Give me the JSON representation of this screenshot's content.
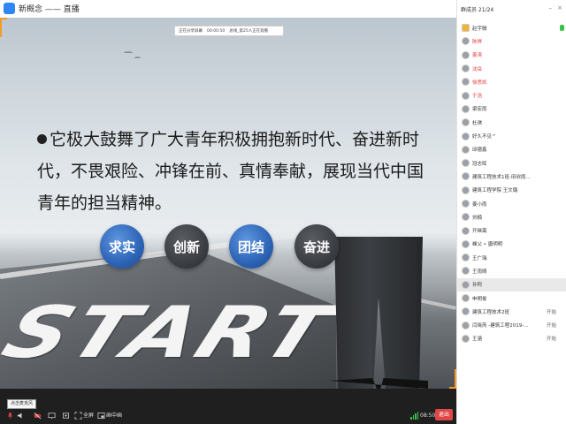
{
  "window": {
    "title": "新概念 —— 直播"
  },
  "info_bar": {
    "sharing": "正在分享屏幕",
    "timer": "00:00:50",
    "viewers": "总线_第25人正在观看"
  },
  "slide": {
    "text": "它极大鼓舞了广大青年积极拥抱新时代、奋进新时代，不畏艰险、冲锋在前、真情奉献，展现当代中国青年的担当精神。",
    "circles": [
      "求实",
      "创新",
      "团结",
      "奋进"
    ],
    "background_word": "START"
  },
  "toolbar": {
    "tooltip": "点击麦克风",
    "fullscreen_label": "全屏",
    "pip_label": "画中画",
    "time": "08:50",
    "exit_label": "退出"
  },
  "panel": {
    "header": "群成员 21/24",
    "participants": [
      {
        "name": "赵宇微",
        "style": "host",
        "status": "",
        "mic": "on"
      },
      {
        "name": "陈晔",
        "style": "red",
        "status": "",
        "mic": ""
      },
      {
        "name": "姜涛",
        "style": "red",
        "status": "",
        "mic": ""
      },
      {
        "name": "沈岳",
        "style": "red",
        "status": "",
        "mic": ""
      },
      {
        "name": "徐思凯",
        "style": "red",
        "status": "",
        "mic": ""
      },
      {
        "name": "于浩",
        "style": "red",
        "status": "",
        "mic": ""
      },
      {
        "name": "梁宏雨",
        "style": "",
        "status": "",
        "mic": ""
      },
      {
        "name": "杜琪",
        "style": "",
        "status": "",
        "mic": ""
      },
      {
        "name": "好久不见^",
        "style": "",
        "status": "",
        "mic": ""
      },
      {
        "name": "邱德鑫",
        "style": "",
        "status": "",
        "mic": ""
      },
      {
        "name": "冠志晖",
        "style": "",
        "status": "",
        "mic": ""
      },
      {
        "name": "建筑工程技术1班-田欣雨...",
        "style": "",
        "status": "",
        "mic": ""
      },
      {
        "name": "建筑工程学院 王文璐",
        "style": "",
        "status": "",
        "mic": ""
      },
      {
        "name": "姜小雨",
        "style": "",
        "status": "",
        "mic": ""
      },
      {
        "name": "刘楠",
        "style": "",
        "status": "",
        "mic": ""
      },
      {
        "name": "开继嵩",
        "style": "",
        "status": "",
        "mic": ""
      },
      {
        "name": "峰父 • 唐明明",
        "style": "",
        "status": "",
        "mic": ""
      },
      {
        "name": "王广瑞",
        "style": "",
        "status": "",
        "mic": ""
      },
      {
        "name": "王雨晴",
        "style": "",
        "status": "",
        "mic": ""
      },
      {
        "name": "孙阿",
        "style": "",
        "status": "",
        "mic": "",
        "selected": true
      },
      {
        "name": "申明俊",
        "style": "",
        "status": "",
        "mic": ""
      },
      {
        "name": "建筑工程技术2班",
        "style": "",
        "status": "开始",
        "mic": ""
      },
      {
        "name": "闫晓芮 -建筑工程2019-...",
        "style": "",
        "status": "开始",
        "mic": ""
      },
      {
        "name": "王涵",
        "style": "",
        "status": "开始",
        "mic": ""
      }
    ]
  },
  "colors": {
    "accent_blue": "#2d63b5",
    "exit_red": "#e04646",
    "mic_green": "#38c24a",
    "frame_orange": "#f39a2b"
  }
}
